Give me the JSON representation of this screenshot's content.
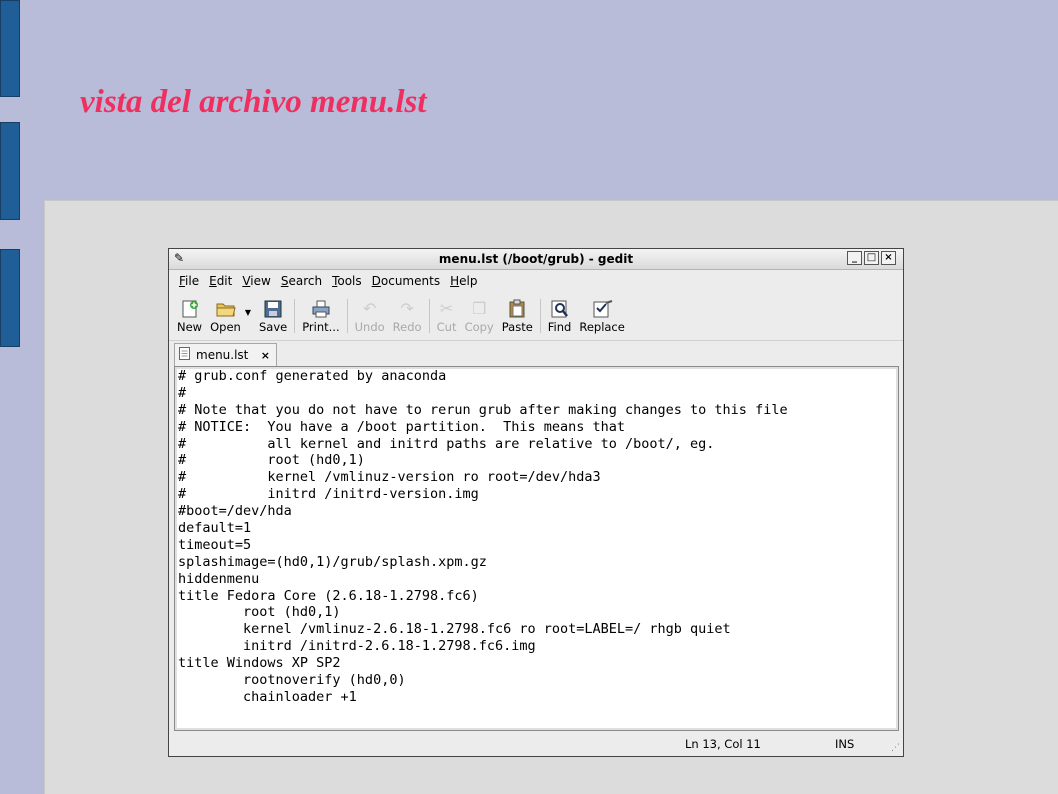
{
  "slide": {
    "title": "vista del archivo menu.lst"
  },
  "window": {
    "title": "menu.lst (/boot/grub) - gedit",
    "controls": [
      "_",
      "□",
      "×"
    ]
  },
  "menu": [
    {
      "pre": "",
      "u": "F",
      "post": "ile"
    },
    {
      "pre": "",
      "u": "E",
      "post": "dit"
    },
    {
      "pre": "",
      "u": "V",
      "post": "iew"
    },
    {
      "pre": "",
      "u": "S",
      "post": "earch"
    },
    {
      "pre": "",
      "u": "T",
      "post": "ools"
    },
    {
      "pre": "",
      "u": "D",
      "post": "ocuments"
    },
    {
      "pre": "",
      "u": "H",
      "post": "elp"
    }
  ],
  "toolbar": {
    "new": "New",
    "open": "Open",
    "save": "Save",
    "print": "Print...",
    "undo": "Undo",
    "redo": "Redo",
    "cut": "Cut",
    "copy": "Copy",
    "paste": "Paste",
    "find": "Find",
    "replace": "Replace"
  },
  "tab": {
    "label": "menu.lst",
    "close": "×"
  },
  "editor_lines": [
    "# grub.conf generated by anaconda",
    "#",
    "# Note that you do not have to rerun grub after making changes to this file",
    "# NOTICE:  You have a /boot partition.  This means that",
    "#          all kernel and initrd paths are relative to /boot/, eg.",
    "#          root (hd0,1)",
    "#          kernel /vmlinuz-version ro root=/dev/hda3",
    "#          initrd /initrd-version.img",
    "#boot=/dev/hda",
    "default=1",
    "timeout=5",
    "splashimage=(hd0,1)/grub/splash.xpm.gz",
    "hiddenmenu",
    "title Fedora Core (2.6.18-1.2798.fc6)",
    "        root (hd0,1)",
    "        kernel /vmlinuz-2.6.18-1.2798.fc6 ro root=LABEL=/ rhgb quiet",
    "        initrd /initrd-2.6.18-1.2798.fc6.img",
    "title Windows XP SP2",
    "        rootnoverify (hd0,0)",
    "        chainloader +1"
  ],
  "status": {
    "position": "Ln 13, Col 11",
    "mode": "INS"
  }
}
